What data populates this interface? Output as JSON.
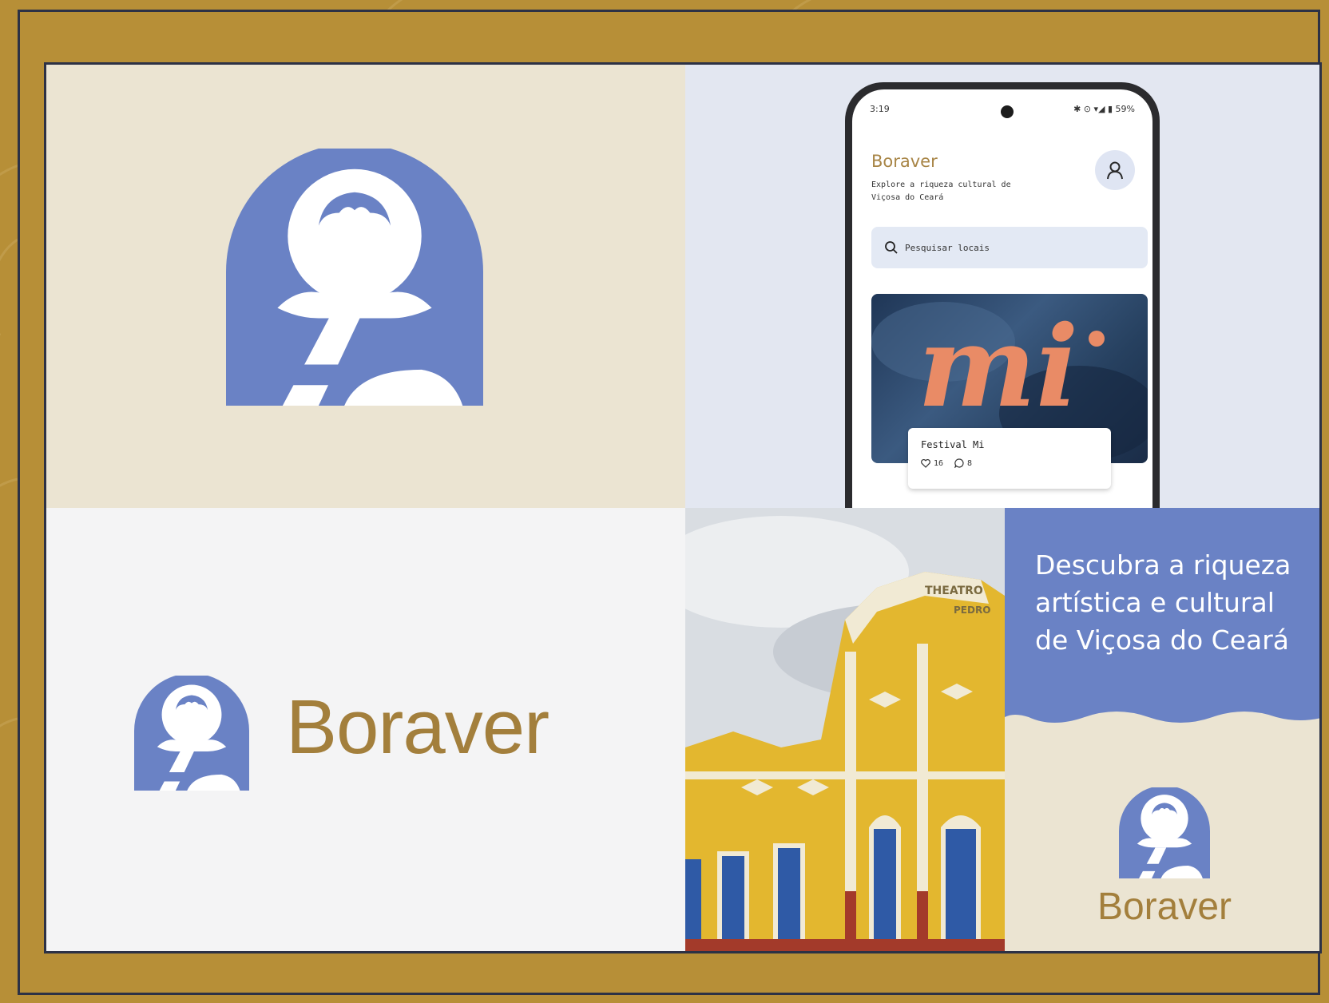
{
  "colors": {
    "gold_background": "#b78f37",
    "navy_border": "#2c3145",
    "brand_blue": "#6a82c5",
    "brand_gold": "#a37f3c",
    "cream": "#ebe4d2"
  },
  "phone": {
    "status_time": "3:19",
    "status_right": "✱ ⊙ ▾◢ ▮ 59%",
    "app_title": "Boraver",
    "app_subtitle": "Explore a riqueza cultural de Viçosa do Ceará",
    "search_placeholder": "Pesquisar locais",
    "card": {
      "name": "Festival Mi",
      "likes": "16",
      "comments": "8",
      "image_text": "mi"
    }
  },
  "lockup": {
    "wordmark": "Boraver"
  },
  "promo": {
    "headline": "Descubra a riqueza artística e cultural de Viçosa do Ceará",
    "wordmark": "Boraver",
    "building_sign_top": "THEATRO",
    "building_sign_bottom": "PEDRO"
  },
  "icons": {
    "logo": "boraver-logo-icon",
    "profile": "user-icon",
    "search": "search-icon",
    "like": "heart-icon",
    "comment": "comment-icon"
  }
}
